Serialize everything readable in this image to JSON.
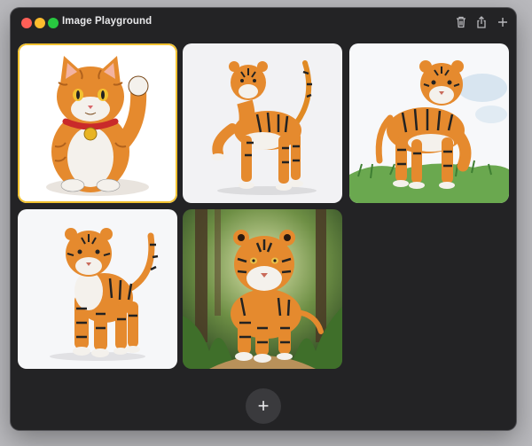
{
  "window": {
    "title": "Image Playground"
  },
  "toolbar": {
    "icons": [
      "trash-icon",
      "share-icon",
      "plus-icon"
    ]
  },
  "gallery": {
    "items": [
      {
        "subject": "lucky cat figurine",
        "selected": true
      },
      {
        "subject": "walking tiger on white",
        "selected": false
      },
      {
        "subject": "tiger on grass",
        "selected": false
      },
      {
        "subject": "standing tiger front view",
        "selected": false
      },
      {
        "subject": "tiger in forest",
        "selected": false
      }
    ]
  },
  "add_button": {
    "label": "+"
  },
  "colors": {
    "window_bg": "#232325",
    "selection": "#f2c230",
    "close": "#fe5f57",
    "minimize": "#febc2e",
    "maximize": "#28c840"
  }
}
